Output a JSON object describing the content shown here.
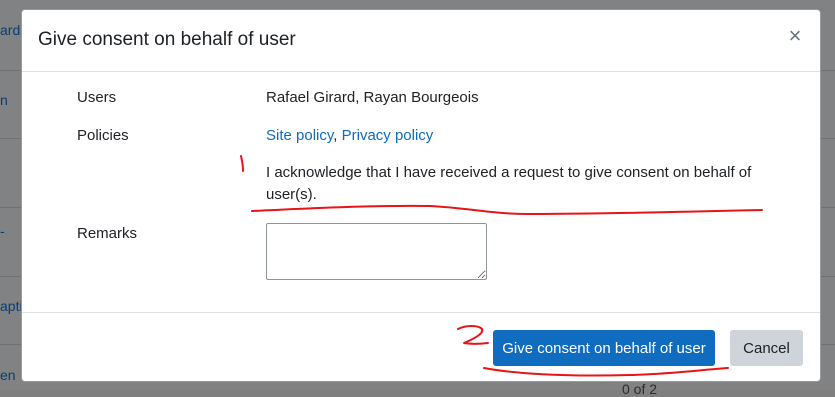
{
  "background": {
    "edge_texts": [
      "ard",
      "n",
      "-",
      "aptic",
      "en"
    ],
    "footer_text": "0 of 2"
  },
  "modal": {
    "title": "Give consent on behalf of user",
    "close_glyph": "×",
    "users_label": "Users",
    "users_value": "Rafael Girard, Rayan Bourgeois",
    "policies_label": "Policies",
    "policy_link_1": "Site policy",
    "policy_separator": ", ",
    "policy_link_2": "Privacy policy",
    "acknowledgement": "I acknowledge that I have received a request to give consent on behalf of user(s).",
    "remarks_label": "Remarks",
    "remarks_value": ""
  },
  "footer": {
    "primary_button": "Give consent on behalf of user",
    "cancel_button": "Cancel"
  },
  "annotations": {
    "mark_1": "1",
    "mark_2": "2",
    "color": "#e8141a"
  },
  "colors": {
    "primary": "#0f6cbf",
    "secondary": "#ced4da",
    "link": "#0f6cbf"
  }
}
